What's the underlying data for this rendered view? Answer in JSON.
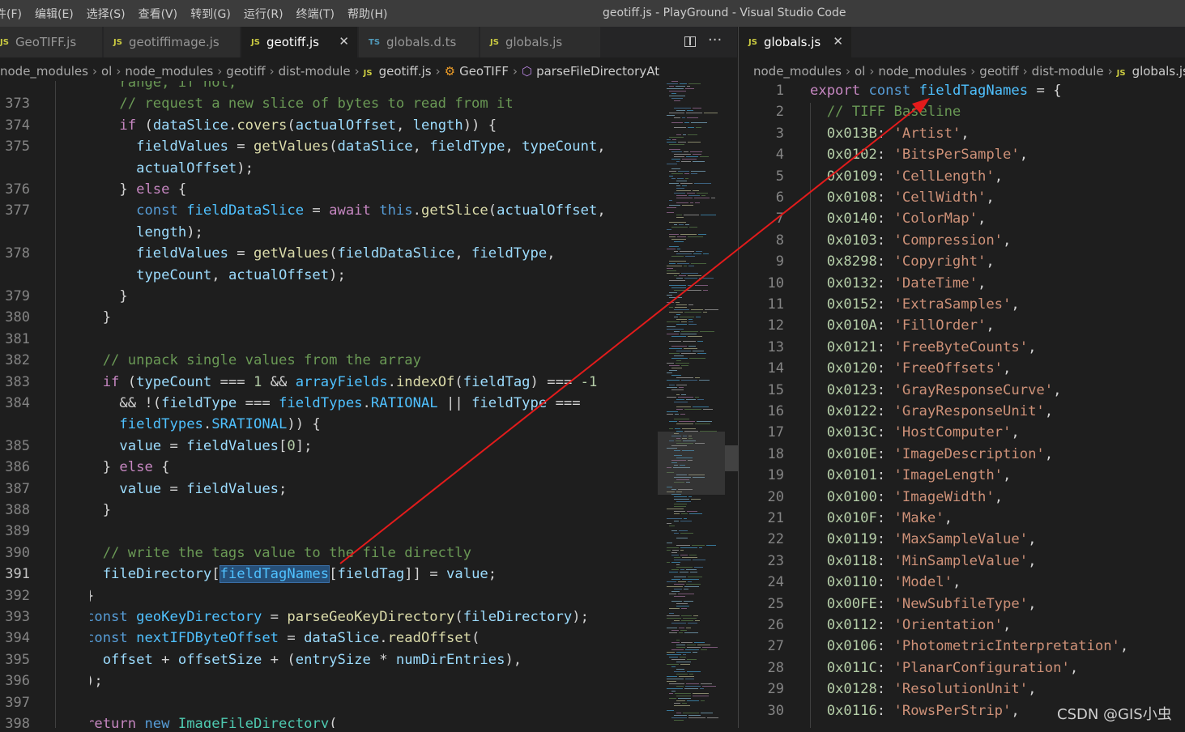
{
  "window": {
    "title": "geotiff.js - PlayGround - Visual Studio Code",
    "menu": [
      "件(F)",
      "编辑(E)",
      "选择(S)",
      "查看(V)",
      "转到(G)",
      "运行(R)",
      "终端(T)",
      "帮助(H)"
    ]
  },
  "left_tabs": [
    {
      "icon": "JS",
      "label": "GeoTIFF.js"
    },
    {
      "icon": "JS",
      "label": "geotiffimage.js"
    },
    {
      "icon": "JS",
      "label": "geotiff.js",
      "close": "✕"
    },
    {
      "icon": "TS",
      "label": "globals.d.ts"
    },
    {
      "icon": "JS",
      "label": "globals.js"
    }
  ],
  "right_tabs": [
    {
      "icon": "JS",
      "label": "globals.js",
      "close": "✕"
    }
  ],
  "left_breadcrumb": [
    "node_modules",
    "ol",
    "node_modules",
    "geotiff",
    "dist-module",
    "JS geotiff.js",
    "GeoTIFF",
    "parseFileDirectoryAt"
  ],
  "right_breadcrumb": [
    "node_modules",
    "ol",
    "node_modules",
    "geotiff",
    "dist-module",
    "JS globals.js"
  ],
  "left_editor": {
    "current_line": "391",
    "rows": [
      {
        "ln": "",
        "html": "    <span class=\"cmt\">range, if not,</span>"
      },
      {
        "ln": "373",
        "html": "    <span class=\"cmt\">// request a new slice of bytes to read from it</span>"
      },
      {
        "ln": "374",
        "html": "    <span class=\"ctl\">if</span> (<span class=\"var\">dataSlice</span>.<span class=\"fn\">covers</span>(<span class=\"var\">actualOffset</span>, <span class=\"var\">length</span>)) {"
      },
      {
        "ln": "375",
        "html": "      <span class=\"var\">fieldValues</span> = <span class=\"fn\">getValues</span>(<span class=\"var\">dataSlice</span>, <span class=\"var\">fieldType</span>, <span class=\"var\">typeCount</span>,"
      },
      {
        "ln": "",
        "html": "      <span class=\"var\">actualOffset</span>);"
      },
      {
        "ln": "376",
        "html": "    } <span class=\"ctl\">else</span> {"
      },
      {
        "ln": "377",
        "html": "      <span class=\"kw\">const</span> <span class=\"cst\">fieldDataSlice</span> = <span class=\"ctl\">await</span> <span class=\"kw\">this</span>.<span class=\"fn\">getSlice</span>(<span class=\"var\">actualOffset</span>,"
      },
      {
        "ln": "",
        "html": "      <span class=\"var\">length</span>);"
      },
      {
        "ln": "378",
        "html": "      <span class=\"var\">fieldValues</span> = <span class=\"fn\">getValues</span>(<span class=\"var\">fieldDataSlice</span>, <span class=\"var\">fieldType</span>,"
      },
      {
        "ln": "",
        "html": "      <span class=\"var\">typeCount</span>, <span class=\"var\">actualOffset</span>);"
      },
      {
        "ln": "379",
        "html": "    }"
      },
      {
        "ln": "380",
        "html": "  }"
      },
      {
        "ln": "381",
        "html": ""
      },
      {
        "ln": "382",
        "html": "  <span class=\"cmt\">// unpack single values from the array</span>"
      },
      {
        "ln": "383",
        "html": "  <span class=\"ctl\">if</span> (<span class=\"var\">typeCount</span> === <span class=\"num\">1</span> &amp;&amp; <span class=\"cst\">arrayFields</span>.<span class=\"fn\">indexOf</span>(<span class=\"var\">fieldTag</span>) === <span class=\"num\">-1</span>"
      },
      {
        "ln": "384",
        "html": "    &amp;&amp; !(<span class=\"var\">fieldType</span> === <span class=\"cst\">fieldTypes</span>.<span class=\"cst\">RATIONAL</span> || <span class=\"var\">fieldType</span> ==="
      },
      {
        "ln": "",
        "html": "    <span class=\"cst\">fieldTypes</span>.<span class=\"cst\">SRATIONAL</span>)) {"
      },
      {
        "ln": "385",
        "html": "    <span class=\"var\">value</span> = <span class=\"var\">fieldValues</span>[<span class=\"num\">0</span>];"
      },
      {
        "ln": "386",
        "html": "  } <span class=\"ctl\">else</span> {"
      },
      {
        "ln": "387",
        "html": "    <span class=\"var\">value</span> = <span class=\"var\">fieldValues</span>;"
      },
      {
        "ln": "388",
        "html": "  }"
      },
      {
        "ln": "389",
        "html": ""
      },
      {
        "ln": "390",
        "html": "  <span class=\"cmt\">// write the tags value to the file directly</span>"
      },
      {
        "ln": "391",
        "html": "  <span class=\"var\">fileDirectory</span>[<span class=\"cst sel\">fieldTagNames</span>[<span class=\"var\">fieldTag</span>]] = <span class=\"var\">value</span>;"
      },
      {
        "ln": "392",
        "html": "}"
      },
      {
        "ln": "393",
        "html": "<span class=\"kw\">const</span> <span class=\"cst\">geoKeyDirectory</span> = <span class=\"fn\">parseGeoKeyDirectory</span>(<span class=\"var\">fileDirectory</span>);"
      },
      {
        "ln": "394",
        "html": "<span class=\"kw\">const</span> <span class=\"cst\">nextIFDByteOffset</span> = <span class=\"var\">dataSlice</span>.<span class=\"fn\">readOffset</span>("
      },
      {
        "ln": "395",
        "html": "  <span class=\"var\">offset</span> + <span class=\"var\">offsetSize</span> + (<span class=\"var\">entrySize</span> * <span class=\"var\">numDirEntries</span>),"
      },
      {
        "ln": "396",
        "html": ");"
      },
      {
        "ln": "397",
        "html": ""
      },
      {
        "ln": "398",
        "html": "<span class=\"ctl\">return</span> <span class=\"kw\">new</span> <span class=\"cls\">ImageFileDirectory</span>("
      }
    ]
  },
  "right_editor": {
    "rows": [
      {
        "ln": "1",
        "html": "<span class=\"ctl\">export</span> <span class=\"kw\">const</span> <span class=\"cst\">fieldTagNames</span> = {"
      },
      {
        "ln": "2",
        "html": "  <span class=\"cmt\">// TIFF Baseline</span>"
      },
      {
        "ln": "3",
        "html": "  <span class=\"num\">0x013B</span>: <span class=\"str\">'Artist'</span>,"
      },
      {
        "ln": "4",
        "html": "  <span class=\"num\">0x0102</span>: <span class=\"str\">'BitsPerSample'</span>,"
      },
      {
        "ln": "5",
        "html": "  <span class=\"num\">0x0109</span>: <span class=\"str\">'CellLength'</span>,"
      },
      {
        "ln": "6",
        "html": "  <span class=\"num\">0x0108</span>: <span class=\"str\">'CellWidth'</span>,"
      },
      {
        "ln": "7",
        "html": "  <span class=\"num\">0x0140</span>: <span class=\"str\">'ColorMap'</span>,"
      },
      {
        "ln": "8",
        "html": "  <span class=\"num\">0x0103</span>: <span class=\"str\">'Compression'</span>,"
      },
      {
        "ln": "9",
        "html": "  <span class=\"num\">0x8298</span>: <span class=\"str\">'Copyright'</span>,"
      },
      {
        "ln": "10",
        "html": "  <span class=\"num\">0x0132</span>: <span class=\"str\">'DateTime'</span>,"
      },
      {
        "ln": "11",
        "html": "  <span class=\"num\">0x0152</span>: <span class=\"str\">'ExtraSamples'</span>,"
      },
      {
        "ln": "12",
        "html": "  <span class=\"num\">0x010A</span>: <span class=\"str\">'FillOrder'</span>,"
      },
      {
        "ln": "13",
        "html": "  <span class=\"num\">0x0121</span>: <span class=\"str\">'FreeByteCounts'</span>,"
      },
      {
        "ln": "14",
        "html": "  <span class=\"num\">0x0120</span>: <span class=\"str\">'FreeOffsets'</span>,"
      },
      {
        "ln": "15",
        "html": "  <span class=\"num\">0x0123</span>: <span class=\"str\">'GrayResponseCurve'</span>,"
      },
      {
        "ln": "16",
        "html": "  <span class=\"num\">0x0122</span>: <span class=\"str\">'GrayResponseUnit'</span>,"
      },
      {
        "ln": "17",
        "html": "  <span class=\"num\">0x013C</span>: <span class=\"str\">'HostComputer'</span>,"
      },
      {
        "ln": "18",
        "html": "  <span class=\"num\">0x010E</span>: <span class=\"str\">'ImageDescription'</span>,"
      },
      {
        "ln": "19",
        "html": "  <span class=\"num\">0x0101</span>: <span class=\"str\">'ImageLength'</span>,"
      },
      {
        "ln": "20",
        "html": "  <span class=\"num\">0x0100</span>: <span class=\"str\">'ImageWidth'</span>,"
      },
      {
        "ln": "21",
        "html": "  <span class=\"num\">0x010F</span>: <span class=\"str\">'Make'</span>,"
      },
      {
        "ln": "22",
        "html": "  <span class=\"num\">0x0119</span>: <span class=\"str\">'MaxSampleValue'</span>,"
      },
      {
        "ln": "23",
        "html": "  <span class=\"num\">0x0118</span>: <span class=\"str\">'MinSampleValue'</span>,"
      },
      {
        "ln": "24",
        "html": "  <span class=\"num\">0x0110</span>: <span class=\"str\">'Model'</span>,"
      },
      {
        "ln": "25",
        "html": "  <span class=\"num\">0x00FE</span>: <span class=\"str\">'NewSubfileType'</span>,"
      },
      {
        "ln": "26",
        "html": "  <span class=\"num\">0x0112</span>: <span class=\"str\">'Orientation'</span>,"
      },
      {
        "ln": "27",
        "html": "  <span class=\"num\">0x0106</span>: <span class=\"str\">'PhotometricInterpretation'</span>,"
      },
      {
        "ln": "28",
        "html": "  <span class=\"num\">0x011C</span>: <span class=\"str\">'PlanarConfiguration'</span>,"
      },
      {
        "ln": "29",
        "html": "  <span class=\"num\">0x0128</span>: <span class=\"str\">'ResolutionUnit'</span>,"
      },
      {
        "ln": "30",
        "html": "  <span class=\"num\">0x0116</span>: <span class=\"str\">'RowsPerStrip'</span>,"
      }
    ]
  },
  "watermark": "CSDN @GIS小虫",
  "colors": {
    "annotation_arrow": "#e31b1b",
    "selection": "#264f78"
  },
  "icons": {
    "split_editor": "split-editor-icon",
    "more_actions": "more-actions-icon",
    "class_symbol": "class-icon",
    "method_symbol": "method-icon"
  }
}
